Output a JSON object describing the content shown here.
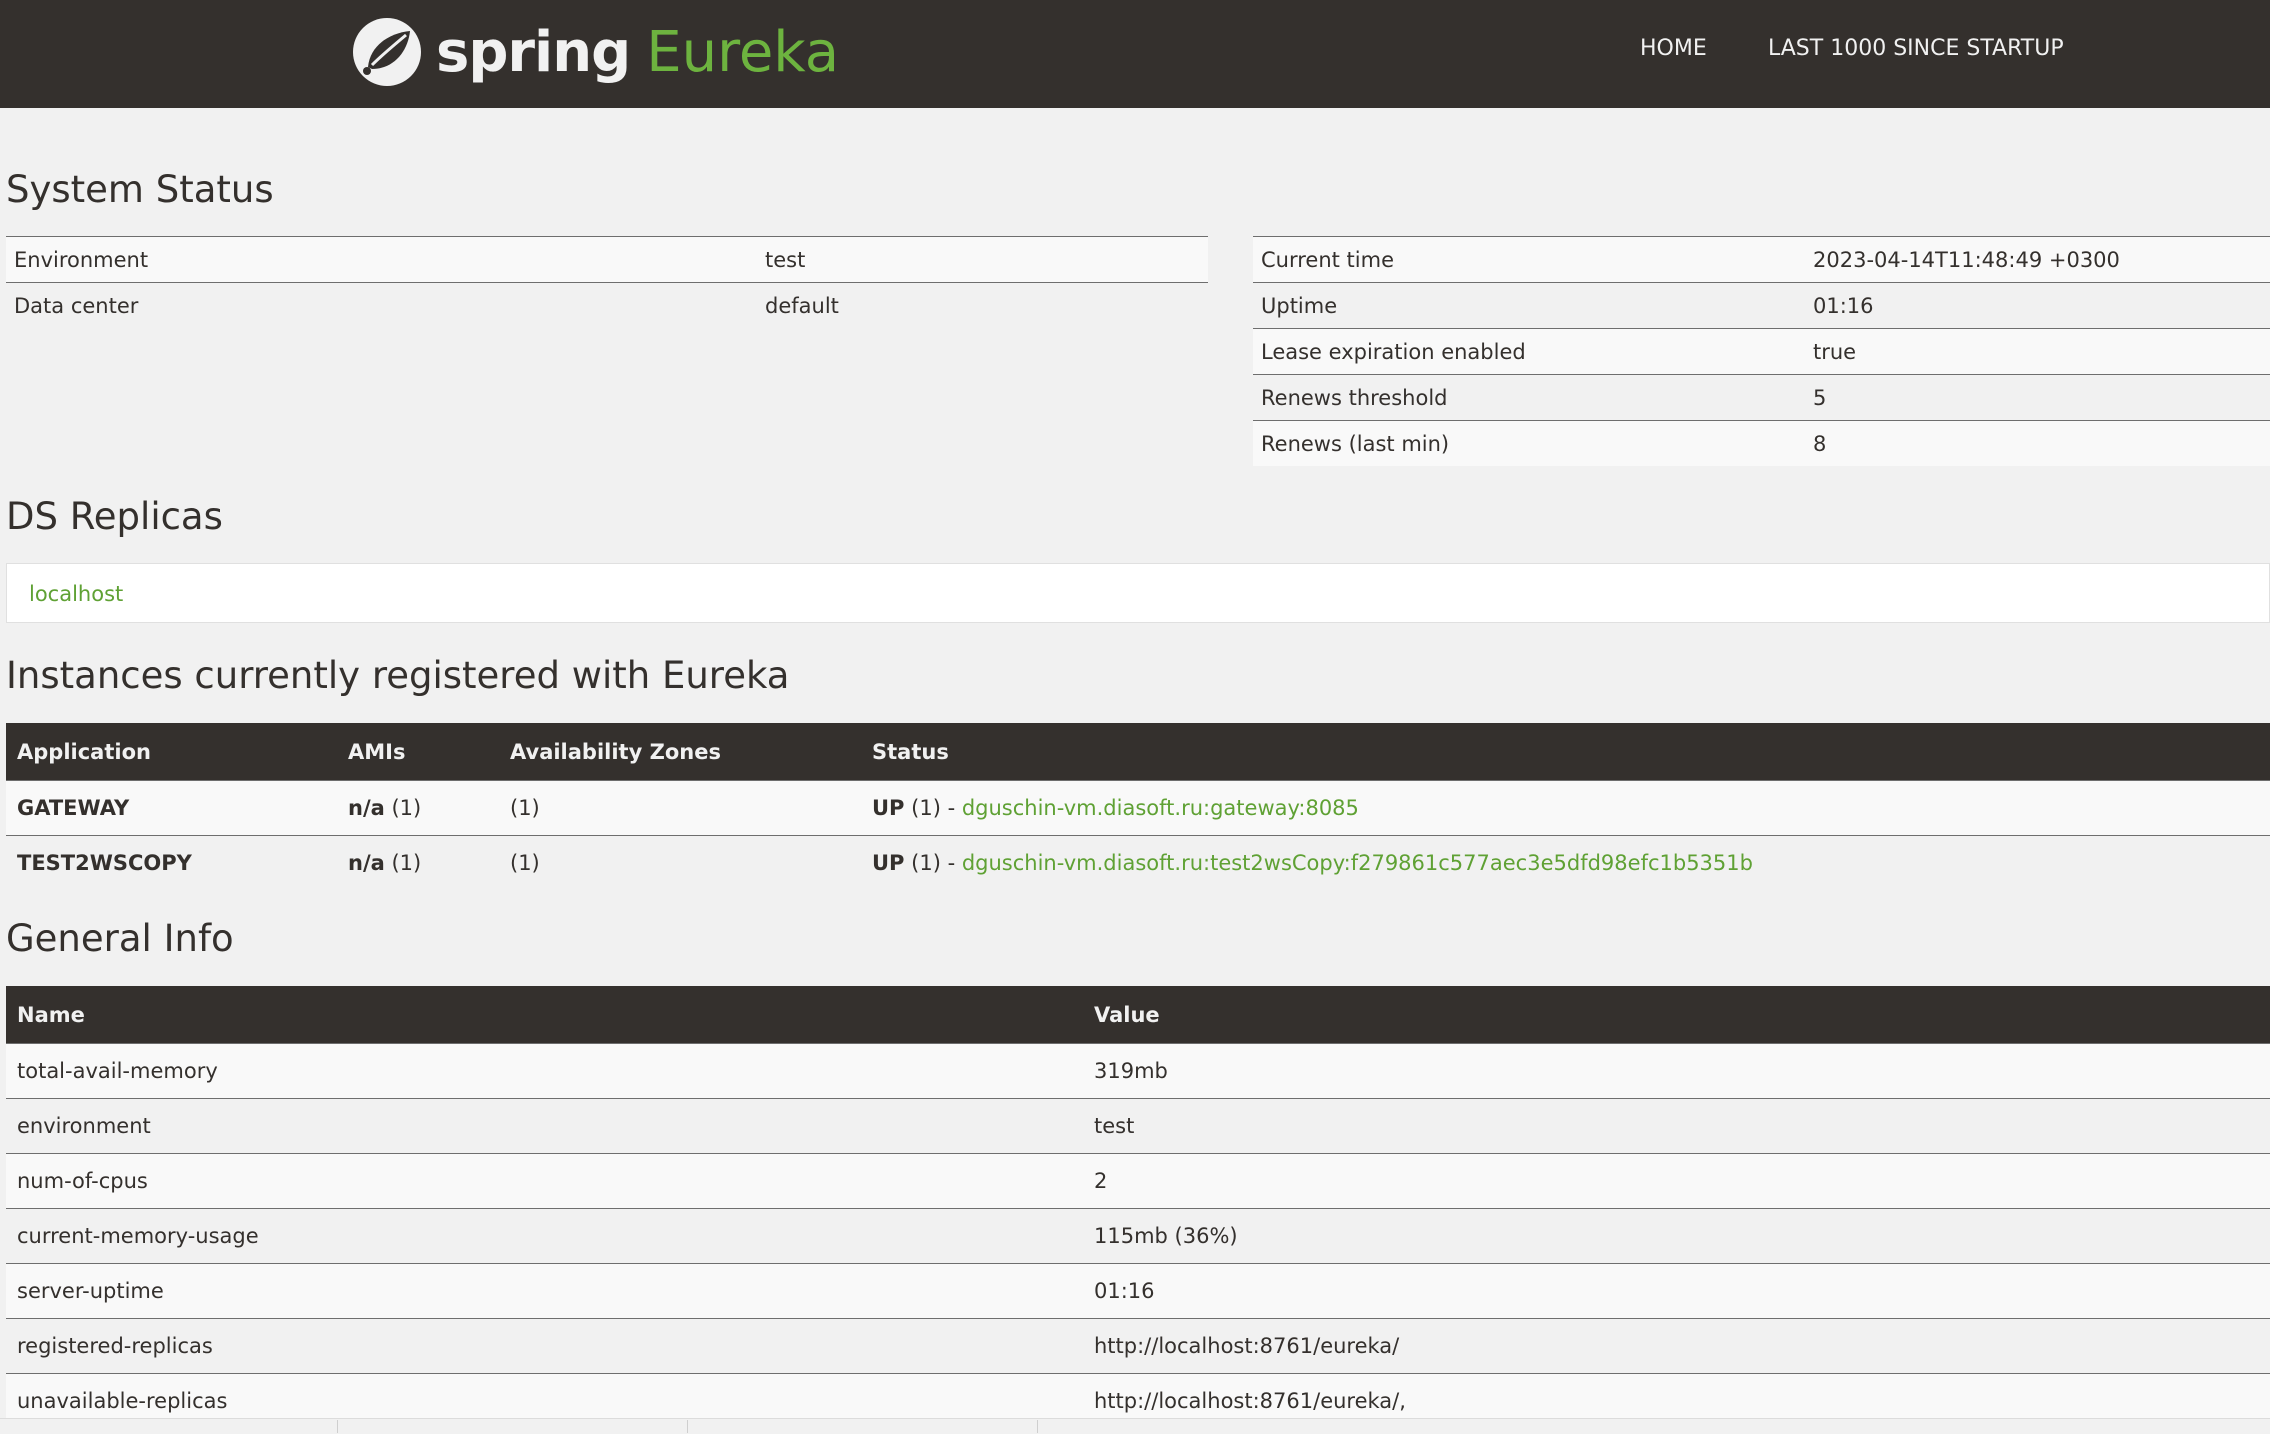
{
  "header": {
    "brand_spring": "spring",
    "brand_eureka": "Eureka",
    "nav": [
      {
        "label": "HOME"
      },
      {
        "label": "LAST 1000 SINCE STARTUP"
      }
    ]
  },
  "system_status": {
    "title": "System Status",
    "left": [
      {
        "key": "Environment",
        "value": "test"
      },
      {
        "key": "Data center",
        "value": "default"
      }
    ],
    "right": [
      {
        "key": "Current time",
        "value": "2023-04-14T11:48:49 +0300"
      },
      {
        "key": "Uptime",
        "value": "01:16"
      },
      {
        "key": "Lease expiration enabled",
        "value": "true"
      },
      {
        "key": "Renews threshold",
        "value": "5"
      },
      {
        "key": "Renews (last min)",
        "value": "8"
      }
    ]
  },
  "ds_replicas": {
    "title": "DS Replicas",
    "items": [
      {
        "label": "localhost"
      }
    ]
  },
  "instances": {
    "title": "Instances currently registered with Eureka",
    "columns": [
      "Application",
      "AMIs",
      "Availability Zones",
      "Status"
    ],
    "rows": [
      {
        "application": "GATEWAY",
        "amis_label": "n/a",
        "amis_count": "(1)",
        "zones": "(1)",
        "status_prefix": "UP",
        "status_count": "(1) -",
        "status_link": "dguschin-vm.diasoft.ru:gateway:8085"
      },
      {
        "application": "TEST2WSCOPY",
        "amis_label": "n/a",
        "amis_count": "(1)",
        "zones": "(1)",
        "status_prefix": "UP",
        "status_count": "(1) -",
        "status_link": "dguschin-vm.diasoft.ru:test2wsCopy:f279861c577aec3e5dfd98efc1b5351b"
      }
    ]
  },
  "general_info": {
    "title": "General Info",
    "columns": [
      "Name",
      "Value"
    ],
    "rows": [
      {
        "name": "total-avail-memory",
        "value": "319mb"
      },
      {
        "name": "environment",
        "value": "test"
      },
      {
        "name": "num-of-cpus",
        "value": "2"
      },
      {
        "name": "current-memory-usage",
        "value": "115mb (36%)"
      },
      {
        "name": "server-uptime",
        "value": "01:16"
      },
      {
        "name": "registered-replicas",
        "value": "http://localhost:8761/eureka/"
      },
      {
        "name": "unavailable-replicas",
        "value": "http://localhost:8761/eureka/,"
      }
    ]
  },
  "colors": {
    "header_bg": "#34302d",
    "accent_green": "#6db33f",
    "link_green": "#5fa134",
    "page_bg": "#f1f1f1"
  }
}
